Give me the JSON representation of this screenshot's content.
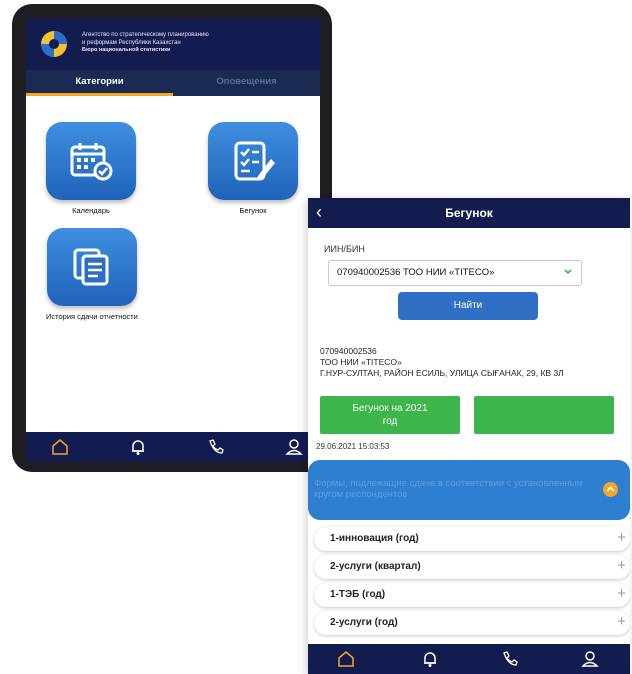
{
  "tablet": {
    "org_name_line1": "Агентство по стратегическому планированию",
    "org_name_line2": "и реформам Республики Казахстан",
    "org_name_line3": "Бюро национальной статистики",
    "tabs": [
      {
        "label": "Категории",
        "active": true
      },
      {
        "label": "Оповещения",
        "active": false
      }
    ],
    "tiles": [
      {
        "label": "Календарь",
        "icon": "calendar-icon"
      },
      {
        "label": "Бегунок",
        "icon": "checklist-icon"
      },
      {
        "label": "История сдачи отчетности",
        "icon": "documents-icon"
      }
    ],
    "bottom_nav": [
      "home-icon",
      "bell-icon",
      "phone-icon",
      "user-icon"
    ]
  },
  "phone": {
    "title": "Бегунок",
    "back_icon": "‹",
    "iin_label": "ИИН/БИН",
    "iin_value": "070940002536 ТОО НИИ «TITECO»",
    "find_button": "Найти",
    "info": {
      "bin": "070940002536",
      "company": "ТОО НИИ «TITECO»",
      "address": "Г.НУР-СУЛТАН, РАЙОН ЕСИЛЬ, УЛИЦА СЫҒАНАК, 29, КВ 3Л"
    },
    "begunok_button_line1": "Бегунок на 2021",
    "begunok_button_line2": "год",
    "second_button": "",
    "date": "29.06.2021 15:03:53",
    "forms_header": "Формы, подлежащие сдаче в соответствии с установленным кругом респондентов",
    "forms": [
      {
        "label": "1-инновация (год)"
      },
      {
        "label": "2-услуги (квартал)"
      },
      {
        "label": "1-ТЭБ (год)"
      },
      {
        "label": "2-услуги (год)"
      }
    ],
    "plus_symbol": "+",
    "bottom_nav": [
      "home-icon",
      "bell-icon",
      "phone-icon",
      "user-icon"
    ]
  },
  "colors": {
    "navy": "#131c4e",
    "tile_blue": "#2f7fd1",
    "green": "#3cb54a",
    "accent_orange": "#f5a623"
  }
}
